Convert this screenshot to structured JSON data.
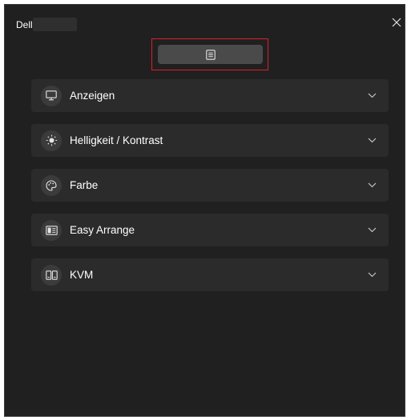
{
  "window": {
    "title": "Dell"
  },
  "toolbar": {
    "menu_icon": "document-list-icon"
  },
  "sections": [
    {
      "label": "Anzeigen",
      "icon": "monitor-icon"
    },
    {
      "label": "Helligkeit / Kontrast",
      "icon": "brightness-icon"
    },
    {
      "label": "Farbe",
      "icon": "palette-icon"
    },
    {
      "label": "Easy Arrange",
      "icon": "layout-icon"
    },
    {
      "label": "KVM",
      "icon": "kvm-icon"
    }
  ],
  "colors": {
    "background": "#202020",
    "row": "#2b2b2b",
    "highlight": "#d9202a"
  }
}
